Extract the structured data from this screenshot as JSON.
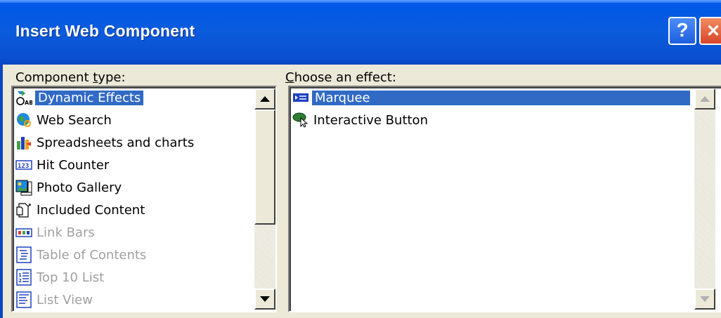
{
  "window": {
    "title": "Insert Web Component",
    "help_label": "?",
    "close_label": "✕"
  },
  "component_type": {
    "label_prefix": "Component ",
    "label_mnemonic": "t",
    "label_suffix": "ype:",
    "items": [
      {
        "label": "Dynamic Effects",
        "icon": "dynamic-effects-icon",
        "selected": true,
        "disabled": false
      },
      {
        "label": "Web Search",
        "icon": "web-search-icon",
        "selected": false,
        "disabled": false
      },
      {
        "label": "Spreadsheets and charts",
        "icon": "spreadsheet-chart-icon",
        "selected": false,
        "disabled": false
      },
      {
        "label": "Hit Counter",
        "icon": "hit-counter-icon",
        "selected": false,
        "disabled": false
      },
      {
        "label": "Photo Gallery",
        "icon": "photo-gallery-icon",
        "selected": false,
        "disabled": false
      },
      {
        "label": "Included Content",
        "icon": "included-content-icon",
        "selected": false,
        "disabled": false
      },
      {
        "label": "Link Bars",
        "icon": "link-bars-icon",
        "selected": false,
        "disabled": true
      },
      {
        "label": "Table of Contents",
        "icon": "table-of-contents-icon",
        "selected": false,
        "disabled": true
      },
      {
        "label": "Top 10 List",
        "icon": "top-10-list-icon",
        "selected": false,
        "disabled": true
      },
      {
        "label": "List View",
        "icon": "list-view-icon",
        "selected": false,
        "disabled": true
      }
    ]
  },
  "effect": {
    "label_mnemonic": "C",
    "label_suffix": "hoose an effect:",
    "items": [
      {
        "label": "Marquee",
        "icon": "marquee-icon",
        "selected": true
      },
      {
        "label": "Interactive Button",
        "icon": "interactive-button-icon",
        "selected": false
      }
    ]
  }
}
